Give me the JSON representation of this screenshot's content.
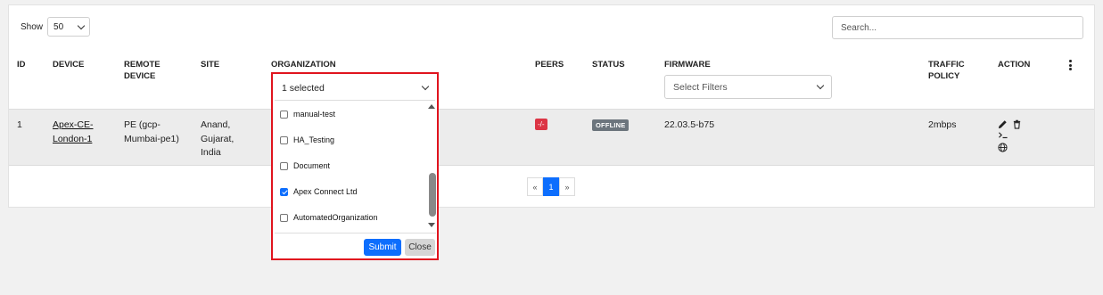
{
  "toolbar": {
    "show_label": "Show",
    "page_size": "50",
    "search_placeholder": "Search..."
  },
  "table": {
    "headers": {
      "id": "ID",
      "device": "DEVICE",
      "remote_device_1": "REMOTE",
      "remote_device_2": "DEVICE",
      "site": "SITE",
      "organization": "ORGANIZATION",
      "peers": "PEERS",
      "status": "STATUS",
      "firmware": "FIRMWARE",
      "traffic_policy_1": "TRAFFIC",
      "traffic_policy_2": "POLICY",
      "action": "ACTION"
    },
    "firmware_filter_placeholder": "Select Filters",
    "rows": [
      {
        "id": "1",
        "device_1": "Apex-CE-",
        "device_2": "London-1",
        "remote_1": "PE (gcp-",
        "remote_2": "Mumbai-pe1)",
        "site_1": "Anand,",
        "site_2": "Gujarat,",
        "site_3": "India",
        "peers": "-/-",
        "status": "OFFLINE",
        "firmware": "22.03.5-b75",
        "traffic_policy": "2mbps"
      }
    ]
  },
  "pagination": {
    "prev": "«",
    "current": "1",
    "next": "»"
  },
  "org_dropdown": {
    "summary": "1 selected",
    "options": [
      {
        "label": "manual-test",
        "checked": false
      },
      {
        "label": "HA_Testing",
        "checked": false
      },
      {
        "label": "Document",
        "checked": false
      },
      {
        "label": "Apex Connect Ltd",
        "checked": true
      },
      {
        "label": "AutomatedOrganization",
        "checked": false
      }
    ],
    "submit_label": "Submit",
    "close_label": "Close"
  },
  "colors": {
    "accent": "#0d6efd",
    "danger": "#dc3545",
    "highlight_border": "#e0141e",
    "status_offline": "#6c757d"
  }
}
